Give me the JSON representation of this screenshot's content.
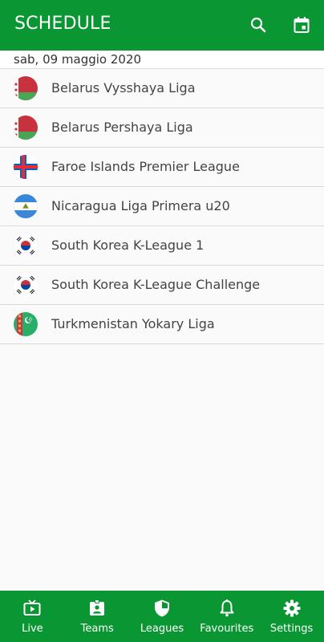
{
  "appbar": {
    "title": "SCHEDULE",
    "icons": [
      "search-icon",
      "calendar-icon"
    ]
  },
  "date_header": "sab, 09 maggio 2020",
  "leagues": [
    {
      "label": "Belarus Vysshaya Liga",
      "flag": "belarus-flag"
    },
    {
      "label": "Belarus Pershaya Liga",
      "flag": "belarus-flag"
    },
    {
      "label": "Faroe Islands Premier League",
      "flag": "faroe-islands-flag"
    },
    {
      "label": "Nicaragua Liga Primera u20",
      "flag": "nicaragua-flag"
    },
    {
      "label": "South Korea K-League 1",
      "flag": "south-korea-flag"
    },
    {
      "label": "South Korea K-League Challenge",
      "flag": "south-korea-flag"
    },
    {
      "label": "Turkmenistan Yokary Liga",
      "flag": "turkmenistan-flag"
    }
  ],
  "bottom_nav": [
    {
      "label": "Live",
      "icon": "tv-icon"
    },
    {
      "label": "Teams",
      "icon": "badge-icon"
    },
    {
      "label": "Leagues",
      "icon": "shield-icon"
    },
    {
      "label": "Favourites",
      "icon": "bell-icon"
    },
    {
      "label": "Settings",
      "icon": "gear-icon"
    }
  ],
  "colors": {
    "primary": "#0a9632",
    "background": "#fafafa",
    "divider": "#d9d9d9"
  }
}
